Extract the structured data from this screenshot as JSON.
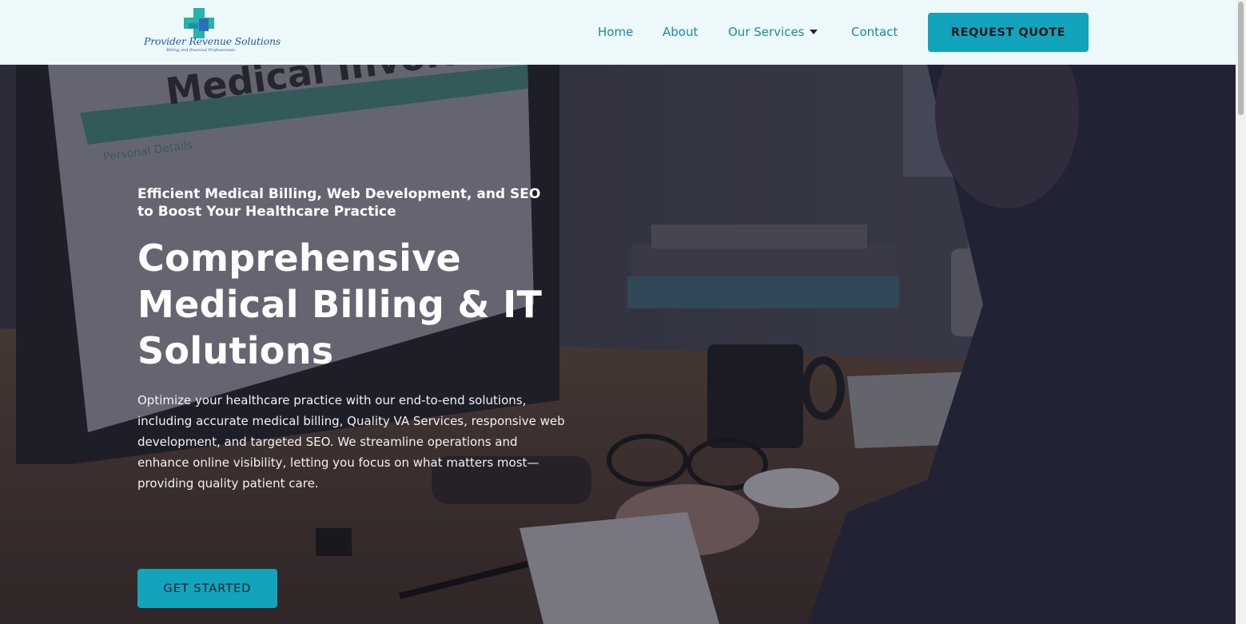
{
  "header": {
    "logo": {
      "title": "Provider Revenue Solutions",
      "tagline": "Billing and financial Professionals"
    },
    "nav": [
      {
        "label": "Home"
      },
      {
        "label": "About"
      },
      {
        "label": "Our Services"
      },
      {
        "label": "Contact"
      }
    ],
    "cta_label": "REQUEST QUOTE"
  },
  "hero": {
    "eyebrow": "Efficient Medical Billing, Web Development, and SEO to Boost Your Healthcare Practice",
    "headline": "Comprehensive Medical Billing & IT Solutions",
    "body": "Optimize your healthcare practice with our end-to-end solutions, including accurate medical billing, Quality VA Services, responsive web development, and targeted SEO. We streamline operations and enhance online visibility, letting you focus on what matters most—providing quality patient care.",
    "cta_label": "GET STARTED",
    "background_text": {
      "invoice_title": "Medical Invoice",
      "section_personal": "Personal Details"
    }
  },
  "colors": {
    "accent": "#12a4bc",
    "nav_text": "#1a8ba3",
    "header_bg": "#eef9fb",
    "logo_blue": "#1f5aa8"
  },
  "icons": {
    "logo_mark": "medical-cross-icon",
    "dropdown": "caret-down-icon"
  }
}
